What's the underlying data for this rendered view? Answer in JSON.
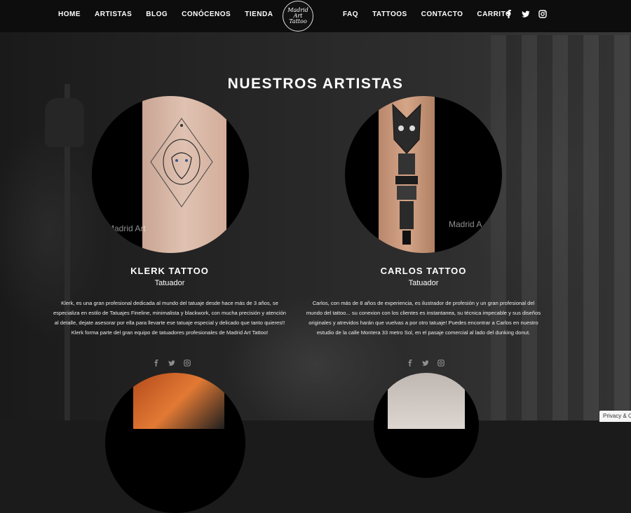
{
  "nav": {
    "left": [
      "HOME",
      "ARTISTAS",
      "BLOG",
      "CONÓCENOS",
      "TIENDA"
    ],
    "right": [
      "FAQ",
      "TATTOOS",
      "CONTACTO",
      "CARRITO"
    ],
    "socials": [
      "facebook-icon",
      "twitter-icon",
      "instagram-icon"
    ],
    "logo_lines": [
      "Madrid",
      "Art",
      "Tattoo"
    ]
  },
  "section": {
    "title": "NUESTROS ARTISTAS"
  },
  "artists": [
    {
      "name": "KLERK TATTOO",
      "role": "Tatuador",
      "watermark": "Madrid Art",
      "bio": "Klerk, es una gran profesional dedicada al mundo del tatuaje desde hace más de 3 años, se especializa en estilo de Tatuajes Fineline, minimalista y blackwork, con mucha precisión y atención al detalle, dejate asesorar por ella para llevarte ese tatuaje especial y delicado que tanto quieres!! Klerk forma parte del gran equipo de tatuadores profesionales de Madrid Art Tattoo!"
    },
    {
      "name": "CARLOS TATTOO",
      "role": "Tatuador",
      "watermark": "Madrid A",
      "bio": "Carlos, con más de 8 años de experiencia, es ilustrador de profesión y un gran profesional del mundo del tattoo... su conexion con los clientes es instantanea, su técnica impecable y sus diseños originales y atrevidos harán que vuelvas a por otro tatuaje! Puedes encontrar a Carlos en nuestro estudio de la calle Montera 33 metro Sol, en el pasaje comercial al lado del dunking donut."
    }
  ],
  "privacy": {
    "label": "Privacy & C"
  }
}
